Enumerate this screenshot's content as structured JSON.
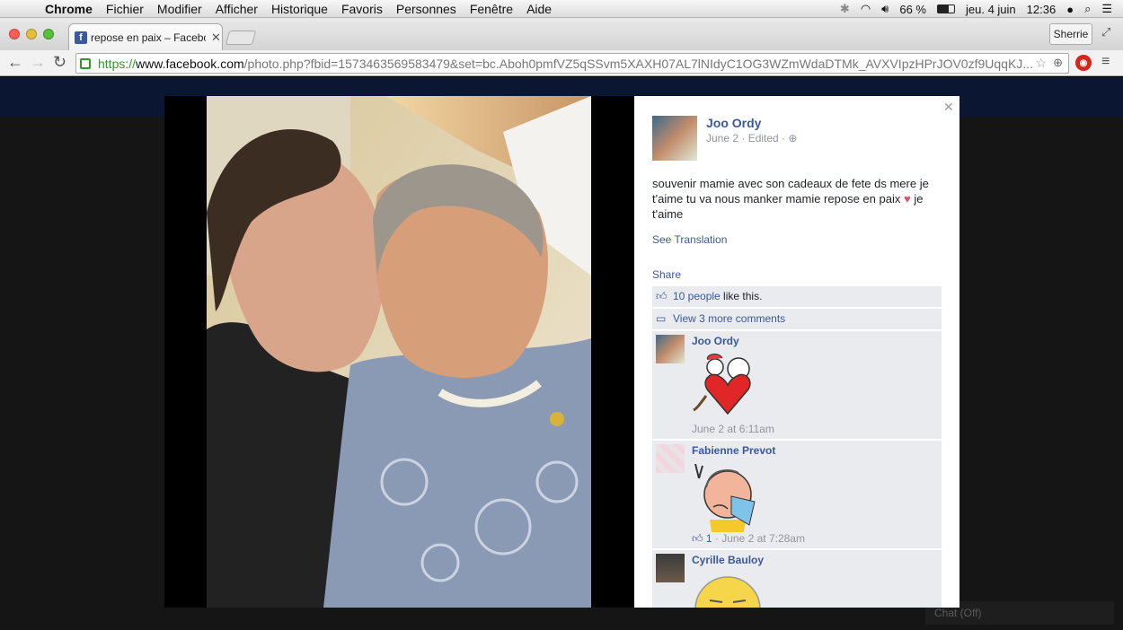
{
  "menubar": {
    "app": "Chrome",
    "menus": [
      "Fichier",
      "Modifier",
      "Afficher",
      "Historique",
      "Favoris",
      "Personnes",
      "Fenêtre",
      "Aide"
    ],
    "battery": "66 %",
    "date": "jeu. 4 juin",
    "time": "12:36"
  },
  "browser": {
    "tab_title": "repose en paix – Facebook",
    "profile": "Sherrie",
    "url_scheme": "https://",
    "url_host": "www.facebook.com",
    "url_path": "/photo.php?fbid=1573463569583479&set=bc.Aboh0pmfVZ5qSSvm5XAXH07AL7lNIdyC1OG3WZmWdaDTMk_AVXVIpzHPrJOV0zf9UqqKJ..."
  },
  "page": {
    "chat_label": "Chat (Off)"
  },
  "post": {
    "author": "Joo Ordy",
    "date": "June 2 · Edited ·",
    "text_part1": "souvenir mamie avec son cadeaux de fete ds mere je t'aime tu va nous manker mamie repose en paix",
    "text_part2": "je t'aime",
    "see_translation": "See Translation",
    "share": "Share",
    "likes_link": "10 people",
    "likes_suffix": " like this.",
    "more_comments": "View 3 more comments"
  },
  "comments": [
    {
      "name": "Joo Ordy",
      "meta": "June 2 at 6:11am",
      "sticker": "heart-hug-sticker"
    },
    {
      "name": "Fabienne Prevot",
      "likes": "1",
      "meta": " · June 2 at 7:28am",
      "sticker": "crying-tissue-sticker"
    },
    {
      "name": "Cyrille Bauloy",
      "meta": "",
      "sticker": "sad-face-sticker"
    }
  ],
  "colors": {
    "facebook_blue": "#3b5998",
    "ufi_grey": "#e9ebee",
    "meta_grey": "#90949c"
  }
}
